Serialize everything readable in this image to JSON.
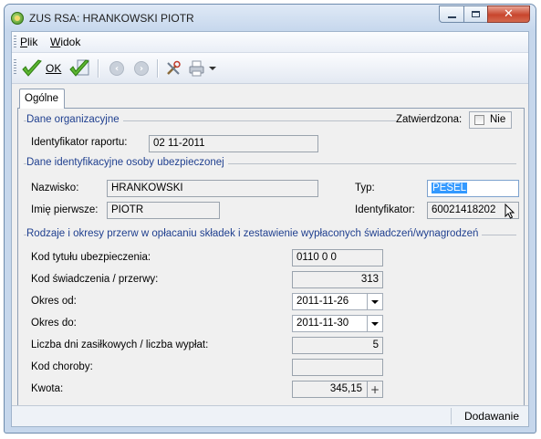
{
  "window": {
    "title": "ZUS RSA: HRANKOWSKI PIOTR"
  },
  "menu": {
    "items": [
      {
        "underline": "P",
        "rest": "lik"
      },
      {
        "underline": "W",
        "rest": "idok"
      }
    ]
  },
  "toolbar": {
    "ok_label": "OK"
  },
  "tabs": [
    "Ogólne"
  ],
  "sections": {
    "organizational": {
      "title": "Dane organizacyjne",
      "approved_label": "Zatwierdzona:",
      "approved_value": "Nie",
      "report_id_label": "Identyfikator raportu:",
      "report_id_value": "02 11-2011"
    },
    "person": {
      "title": "Dane identyfikacyjne osoby ubezpieczonej",
      "surname_label": "Nazwisko:",
      "surname_value": "HRANKOWSKI",
      "firstname_label": "Imię pierwsze:",
      "firstname_value": "PIOTR",
      "type_label": "Typ:",
      "type_value": "PESEL",
      "identifier_label": "Identyfikator:",
      "identifier_value": "60021418202"
    },
    "breaks": {
      "title": "Rodzaje i okresy przerw w opłacaniu składek i zestawienie wypłaconych świadczeń/wynagrodzeń",
      "rows": [
        {
          "label": "Kod tytułu ubezpieczenia:",
          "value": "0110 0 0"
        },
        {
          "label": "Kod świadczenia / przerwy:",
          "value": "313"
        },
        {
          "label": "Okres od:",
          "value": "2011-11-26"
        },
        {
          "label": "Okres do:",
          "value": "2011-11-30"
        },
        {
          "label": "Liczba dni zasiłkowych / liczba wypłat:",
          "value": "5"
        },
        {
          "label": "Kod choroby:",
          "value": ""
        },
        {
          "label": "Kwota:",
          "value": "345,15"
        }
      ]
    }
  },
  "status": {
    "mode": "Dodawanie"
  }
}
